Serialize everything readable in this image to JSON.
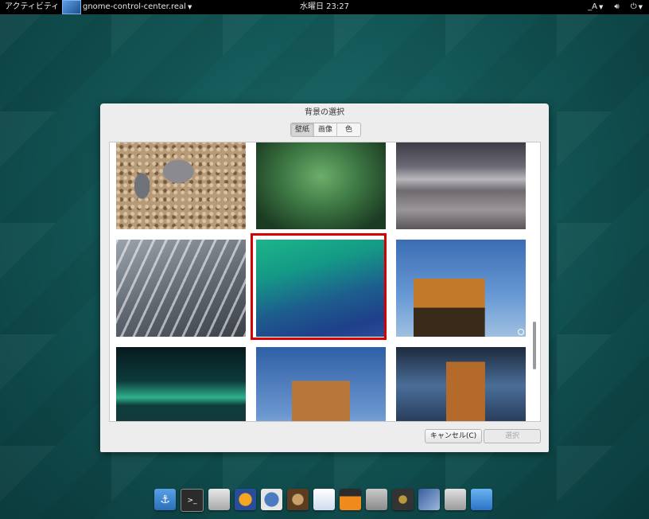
{
  "topbar": {
    "activities": "アクティビティ",
    "app_name": "gnome-control-center.real",
    "clock": "水曜日 23:27",
    "input_method": "_A",
    "volume_icon": "speaker-icon",
    "power_icon": "power-icon"
  },
  "dialog": {
    "title": "背景の選択",
    "tabs": [
      {
        "label": "壁紙",
        "active": true
      },
      {
        "label": "画像",
        "active": false
      },
      {
        "label": "色",
        "active": false
      }
    ],
    "wallpapers": [
      {
        "name": "pebbles",
        "selected": false
      },
      {
        "name": "green-glow",
        "selected": false
      },
      {
        "name": "stormy-sea",
        "selected": false
      },
      {
        "name": "frosted-grass",
        "selected": false
      },
      {
        "name": "aurora-blue-green",
        "selected": true
      },
      {
        "name": "castle-sunset",
        "selected": false,
        "badge": true
      },
      {
        "name": "aurora-horizon",
        "selected": false
      },
      {
        "name": "castle-blue-sky",
        "selected": false
      },
      {
        "name": "castle-cloudy",
        "selected": false
      }
    ],
    "cancel_label": "キャンセル(C)",
    "select_label": "選択"
  },
  "dock": {
    "apps": [
      "anchor-icon",
      "terminal-icon",
      "file-manager-icon",
      "firefox-icon",
      "mail-icon",
      "speaker-app-icon",
      "chat-icon",
      "vlc-icon",
      "mixer-icon",
      "music-player-icon",
      "image-viewer-icon",
      "trash-icon",
      "desktop-icon"
    ]
  },
  "colors": {
    "selection": "#d40000",
    "topbar": "#000000",
    "desktop": "#135656"
  }
}
